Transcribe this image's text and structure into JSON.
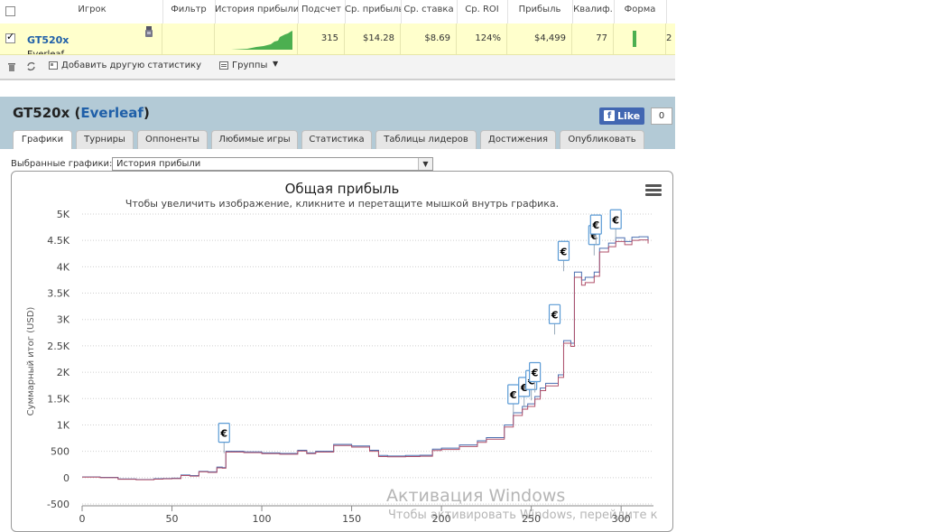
{
  "grid": {
    "columns": [
      "Игрок",
      "Фильтр",
      "История прибыли",
      "Подсчет",
      "Ср. прибыль",
      "Ср. ставка",
      "Ср. ROI",
      "Прибыль",
      "Квалиф.",
      "Форма"
    ],
    "row": {
      "player": "GT520x",
      "site": "Everleaf",
      "count": "315",
      "avg_profit": "$14.28",
      "avg_stake": "$8.69",
      "avg_roi": "124%",
      "profit": "$4,499",
      "qualification": "77",
      "trailing": "2"
    },
    "toolbar": {
      "add_stats": "Добавить другую статистику",
      "groups": "Группы"
    }
  },
  "panel": {
    "title_player": "GT520x",
    "title_site": "Everleaf",
    "fb_like": "Like",
    "fb_count": "0",
    "tabs": [
      "Графики",
      "Турниры",
      "Оппоненты",
      "Любимые игры",
      "Статистика",
      "Таблицы лидеров",
      "Достижения",
      "Опубликовать"
    ],
    "selected_label": "Выбранные графики:",
    "selected_value": "История прибыли"
  },
  "chart_data": {
    "type": "line",
    "title": "Общая прибыль",
    "subtitle": "Чтобы увеличить изображение, кликните и перетащите мышкой внутрь графика.",
    "ylabel": "Суммарный итог (USD)",
    "xlim": [
      0,
      318
    ],
    "ylim": [
      -500,
      5000
    ],
    "x_ticks": [
      0,
      50,
      100,
      150,
      200,
      250,
      300
    ],
    "y_ticks": [
      {
        "v": 5000,
        "label": "5K"
      },
      {
        "v": 4500,
        "label": "4.5K"
      },
      {
        "v": 4000,
        "label": "4K"
      },
      {
        "v": 3500,
        "label": "3.5K"
      },
      {
        "v": 3000,
        "label": "3K"
      },
      {
        "v": 2500,
        "label": "2.5K"
      },
      {
        "v": 2000,
        "label": "2K"
      },
      {
        "v": 1500,
        "label": "1.5K"
      },
      {
        "v": 1000,
        "label": "1K"
      },
      {
        "v": 500,
        "label": "500"
      },
      {
        "v": 0,
        "label": "0"
      },
      {
        "v": -500,
        "label": "-500"
      }
    ],
    "grid": true,
    "series": [
      {
        "color": "#4a6fb0",
        "points": [
          [
            0,
            15
          ],
          [
            10,
            5
          ],
          [
            20,
            -25
          ],
          [
            30,
            -35
          ],
          [
            40,
            -20
          ],
          [
            45,
            -15
          ],
          [
            50,
            -10
          ],
          [
            55,
            50
          ],
          [
            60,
            40
          ],
          [
            65,
            120
          ],
          [
            70,
            110
          ],
          [
            75,
            200
          ],
          [
            78,
            190
          ],
          [
            80,
            500
          ],
          [
            90,
            490
          ],
          [
            100,
            470
          ],
          [
            110,
            460
          ],
          [
            120,
            520
          ],
          [
            125,
            470
          ],
          [
            130,
            500
          ],
          [
            140,
            630
          ],
          [
            150,
            600
          ],
          [
            160,
            520
          ],
          [
            165,
            420
          ],
          [
            170,
            410
          ],
          [
            180,
            420
          ],
          [
            188,
            425
          ],
          [
            195,
            540
          ],
          [
            200,
            560
          ],
          [
            210,
            620
          ],
          [
            220,
            700
          ],
          [
            225,
            760
          ],
          [
            230,
            760
          ],
          [
            235,
            1000
          ],
          [
            240,
            1230
          ],
          [
            245,
            1350
          ],
          [
            248,
            1400
          ],
          [
            252,
            1540
          ],
          [
            255,
            1700
          ],
          [
            258,
            1790
          ],
          [
            265,
            1950
          ],
          [
            268,
            2600
          ],
          [
            272,
            2550
          ],
          [
            274,
            3900
          ],
          [
            278,
            3750
          ],
          [
            280,
            3800
          ],
          [
            285,
            3900
          ],
          [
            288,
            4350
          ],
          [
            293,
            4450
          ],
          [
            297,
            4550
          ],
          [
            302,
            4480
          ],
          [
            306,
            4560
          ],
          [
            310,
            4570
          ],
          [
            315,
            4500
          ]
        ]
      },
      {
        "color": "#b0506a",
        "points": [
          [
            0,
            10
          ],
          [
            10,
            0
          ],
          [
            20,
            -30
          ],
          [
            30,
            -40
          ],
          [
            40,
            -28
          ],
          [
            45,
            -22
          ],
          [
            50,
            -18
          ],
          [
            55,
            40
          ],
          [
            60,
            30
          ],
          [
            65,
            110
          ],
          [
            70,
            100
          ],
          [
            75,
            185
          ],
          [
            78,
            180
          ],
          [
            80,
            485
          ],
          [
            90,
            475
          ],
          [
            100,
            455
          ],
          [
            110,
            445
          ],
          [
            120,
            505
          ],
          [
            125,
            455
          ],
          [
            130,
            485
          ],
          [
            140,
            610
          ],
          [
            150,
            580
          ],
          [
            160,
            500
          ],
          [
            165,
            400
          ],
          [
            170,
            395
          ],
          [
            180,
            400
          ],
          [
            188,
            405
          ],
          [
            195,
            515
          ],
          [
            200,
            535
          ],
          [
            210,
            590
          ],
          [
            220,
            670
          ],
          [
            225,
            730
          ],
          [
            230,
            730
          ],
          [
            235,
            960
          ],
          [
            240,
            1180
          ],
          [
            245,
            1300
          ],
          [
            248,
            1350
          ],
          [
            252,
            1490
          ],
          [
            255,
            1650
          ],
          [
            258,
            1740
          ],
          [
            265,
            1900
          ],
          [
            268,
            2550
          ],
          [
            272,
            2490
          ],
          [
            274,
            3800
          ],
          [
            278,
            3650
          ],
          [
            280,
            3700
          ],
          [
            285,
            3820
          ],
          [
            288,
            4280
          ],
          [
            293,
            4380
          ],
          [
            297,
            4480
          ],
          [
            302,
            4420
          ],
          [
            306,
            4500
          ],
          [
            310,
            4510
          ],
          [
            315,
            4440
          ]
        ]
      }
    ],
    "markers": [
      {
        "x": 79,
        "y": 500,
        "label": "€"
      },
      {
        "x": 240,
        "y": 1230,
        "label": "€"
      },
      {
        "x": 246,
        "y": 1370,
        "label": "€"
      },
      {
        "x": 250,
        "y": 1500,
        "label": "€"
      },
      {
        "x": 252,
        "y": 1650,
        "label": "€"
      },
      {
        "x": 263,
        "y": 2750,
        "label": "€"
      },
      {
        "x": 268,
        "y": 3950,
        "label": "€"
      },
      {
        "x": 285,
        "y": 4250,
        "label": "€"
      },
      {
        "x": 286,
        "y": 4450,
        "label": "€"
      },
      {
        "x": 297,
        "y": 4550,
        "label": "€"
      }
    ]
  },
  "watermark": {
    "line1": "Активация Windows",
    "line2": "Чтобы активировать Windows, перейдите к"
  }
}
